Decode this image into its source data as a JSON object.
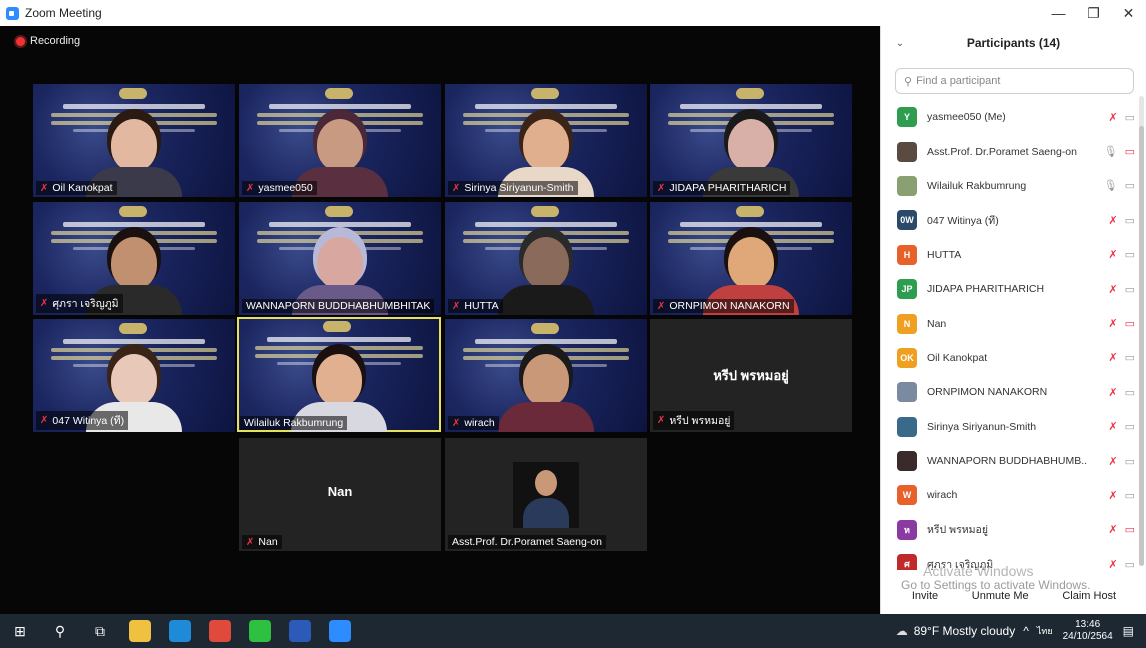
{
  "window": {
    "title": "Zoom Meeting",
    "controls": [
      "—",
      "❐",
      "✕"
    ]
  },
  "recording": {
    "label": "Recording"
  },
  "tiles": [
    {
      "name": "Oil Kanokpat",
      "type": "video",
      "muted": true,
      "skin": "#e2b9a0",
      "hair": "#2a1a12",
      "shirt": "#3a3a4a"
    },
    {
      "name": "yasmee050",
      "type": "video",
      "muted": true,
      "skin": "#c99a82",
      "hair": "#4a2838",
      "shirt": "#5a3040"
    },
    {
      "name": "Sirinya Siriyanun-Smith",
      "type": "video",
      "muted": true,
      "skin": "#e0b08e",
      "hair": "#3a2418",
      "shirt": "#e8d8c8"
    },
    {
      "name": "JIDAPA PHARITHARICH",
      "type": "video",
      "muted": true,
      "skin": "#d8b0a8",
      "hair": "#1a1a1a",
      "shirt": "#3a3a3a"
    },
    {
      "name": "ศุภรา เจริญภูมิ",
      "type": "video",
      "muted": true,
      "skin": "#c09070",
      "hair": "#1a1010",
      "shirt": "#2a2a2a"
    },
    {
      "name": "WANNAPORN BUDDHABHUMBHITAK",
      "type": "video",
      "muted": false,
      "skin": "#d8a8a0",
      "hair": "#b8b8d8",
      "shirt": "#6a5a8a"
    },
    {
      "name": "HUTTA",
      "type": "video",
      "muted": true,
      "skin": "#8a6a5a",
      "hair": "#2a2a2a",
      "shirt": "#1a1a1a"
    },
    {
      "name": "ORNPIMON NANAKORN",
      "type": "video",
      "muted": true,
      "skin": "#e0a878",
      "hair": "#1a1010",
      "shirt": "#c04040"
    },
    {
      "name": "047 Witinya (ที)",
      "type": "video",
      "muted": true,
      "skin": "#e8c8b8",
      "hair": "#3a2418",
      "shirt": "#e8e8e8"
    },
    {
      "name": "Wilailuk Rakbumrung",
      "type": "video",
      "muted": false,
      "speaker": true,
      "skin": "#e0b090",
      "hair": "#1a1010",
      "shirt": "#d8d8e0"
    },
    {
      "name": "wirach",
      "type": "video",
      "muted": true,
      "skin": "#c89878",
      "hair": "#1a1a1a",
      "shirt": "#6a2a3a"
    },
    {
      "name": "หรีป พรหมอยู่",
      "type": "blank",
      "muted": true,
      "display": "หรีป พรหมอยู่"
    },
    {
      "name": "Nan",
      "type": "blank",
      "muted": true,
      "display": "Nan"
    },
    {
      "name": "Asst.Prof. Dr.Poramet Saeng-on",
      "type": "photo",
      "muted": false
    }
  ],
  "panel": {
    "title": "Participants (14)",
    "search_placeholder": "Find a participant",
    "participants": [
      {
        "initials": "Y",
        "color": "#2e9d4f",
        "name": "yasmee050 (Me)",
        "mic": "muted",
        "cam": "on"
      },
      {
        "initials": "",
        "color": "#5a4a40",
        "name": "Asst.Prof. Dr.Poramet Saeng-on",
        "mic": "on",
        "cam": "off"
      },
      {
        "initials": "",
        "color": "#8aa070",
        "name": "Wilailuk Rakbumrung",
        "mic": "on",
        "cam": "on"
      },
      {
        "initials": "0W",
        "color": "#2a4a6a",
        "name": "047 Witinya (ที)",
        "mic": "muted",
        "cam": "on"
      },
      {
        "initials": "H",
        "color": "#e8602a",
        "name": "HUTTA",
        "mic": "muted",
        "cam": "on"
      },
      {
        "initials": "JP",
        "color": "#2e9d4f",
        "name": "JIDAPA PHARITHARICH",
        "mic": "muted",
        "cam": "on"
      },
      {
        "initials": "N",
        "color": "#f0a020",
        "name": "Nan",
        "mic": "muted",
        "cam": "off"
      },
      {
        "initials": "OK",
        "color": "#f0a020",
        "name": "Oil Kanokpat",
        "mic": "muted",
        "cam": "on"
      },
      {
        "initials": "",
        "color": "#7a8aa0",
        "name": "ORNPIMON NANAKORN",
        "mic": "muted",
        "cam": "on"
      },
      {
        "initials": "",
        "color": "#3a6a8a",
        "name": "Sirinya Siriyanun-Smith",
        "mic": "muted",
        "cam": "on"
      },
      {
        "initials": "",
        "color": "#3a2a2a",
        "name": "WANNAPORN BUDDHABHUMB...",
        "mic": "muted",
        "cam": "on"
      },
      {
        "initials": "W",
        "color": "#e8602a",
        "name": "wirach",
        "mic": "muted",
        "cam": "on"
      },
      {
        "initials": "ห",
        "color": "#8a3aa0",
        "name": "หรีป พรหมอยู่",
        "mic": "muted",
        "cam": "off"
      },
      {
        "initials": "ศ",
        "color": "#c02a2a",
        "name": "ศุภรา เจริญภูมิ",
        "mic": "muted",
        "cam": "on"
      }
    ],
    "activation_line1": "Activate Windows",
    "activation_line2": "Go to Settings to activate Windows.",
    "footer": {
      "invite": "Invite",
      "unmute": "Unmute Me",
      "claim_host": "Claim Host"
    }
  },
  "taskbar": {
    "weather": "89°F  Mostly cloudy",
    "lang": "ไทย",
    "time": "13:46",
    "date": "24/10/2564",
    "apps": [
      {
        "name": "file-explorer-icon",
        "color": "#f0c040"
      },
      {
        "name": "edge-icon",
        "color": "#1e8ad8"
      },
      {
        "name": "chrome-icon",
        "color": "#e04a3a"
      },
      {
        "name": "line-icon",
        "color": "#2ec040"
      },
      {
        "name": "word-icon",
        "color": "#2b5ab8"
      },
      {
        "name": "zoom-icon",
        "color": "#2d8cff"
      }
    ]
  }
}
